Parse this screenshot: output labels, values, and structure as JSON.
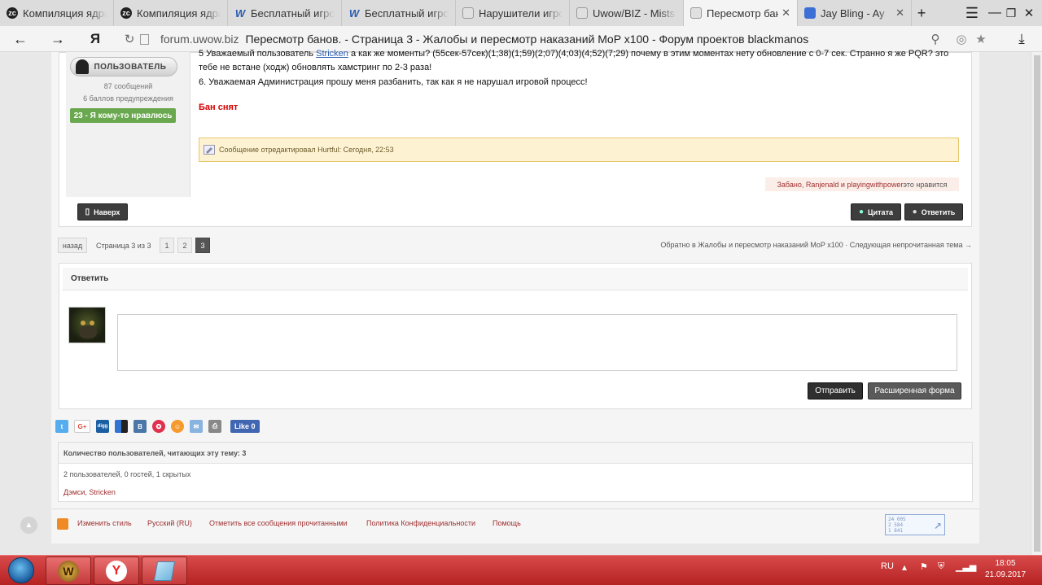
{
  "browser": {
    "tabs": [
      {
        "title": "Компиляция ядра",
        "icon": "zc"
      },
      {
        "title": "Компиляция ядра",
        "icon": "zc"
      },
      {
        "title": "Бесплатный игров",
        "icon": "w"
      },
      {
        "title": "Бесплатный игров",
        "icon": "w"
      },
      {
        "title": "Нарушители игров",
        "icon": "doc"
      },
      {
        "title": "Uwow/BIZ - Mists c",
        "icon": "doc"
      },
      {
        "title": "Пересмотр бано",
        "icon": "doc",
        "active": true
      },
      {
        "title": "Jay Bling - Ay",
        "icon": "blue"
      }
    ],
    "new_tab": "+",
    "domain": "forum.uwow.biz",
    "page_title": "Пересмотр банов. - Страница 3 - Жалобы и пересмотр наказаний MoP x100 - Форум проектов blackmanos",
    "yandex_logo": "Я"
  },
  "post": {
    "rank_label": "ПОЛЬЗОВАТЕЛЬ",
    "messages": "87 сообщений",
    "warnings": "6 баллов предупреждения",
    "likes_badge": "23 - Я кому-то нравлюсь",
    "line1_pre": "5 Уважаемый пользователь ",
    "line1_link": "Stricken",
    "line1_post": " а как же моменты? (55сек-57сек)(1;38)(1;59)(2;07)(4;03)(4;52)(7;29) почему в этим моментах  нету обновление с 0-7 сек. Странно я же PQR? это",
    "line2": "тебе не встане (ходж) обновлять хамстринг по 2-3 раза!",
    "line3": "6. Уважаемая Администрация прошу меня разбанить, так как я не нарушал игровой процесс!",
    "ban_lifted": "Бан снят",
    "edit_note": "Сообщение отредактировал Hurtful: Сегодня, 22:53",
    "likes_names": "Забано, Ranjenald и playingwithpower",
    "likes_suffix": " это нравится",
    "top_button": "Наверх",
    "quote_button": "Цитата",
    "reply_button": "Ответить"
  },
  "pagination": {
    "back": "назад",
    "page_of": "Страница 3 из 3",
    "pages": [
      "1",
      "2",
      "3"
    ],
    "current": "3",
    "back_link": "Обратно в Жалобы и пересмотр наказаний MoP x100 · Следующая непрочитанная тема →"
  },
  "reply": {
    "title": "Ответить",
    "textarea_value": "",
    "send": "Отправить",
    "advanced": "Расширенная форма"
  },
  "social": {
    "icons": [
      "twitter-icon",
      "google-plus-icon",
      "digg-icon",
      "delicious-icon",
      "vkontakte-icon",
      "star-icon",
      "odnoklassniki-icon",
      "mail-icon",
      "print-icon"
    ],
    "like_label": "Like 0"
  },
  "readers": {
    "header": "Количество пользователей, читающих эту тему: 3",
    "counts": "2 пользователей, 0 гостей, 1 скрытых",
    "names": "Дэмси, Stricken"
  },
  "footer": {
    "links": [
      "Изменить стиль",
      "Русский (RU)",
      "Отметить все сообщения прочитанными",
      "Политика Конфиденциальности",
      "Помощь"
    ],
    "counter_lines": [
      "24 005",
      "2 584",
      "1 841"
    ]
  },
  "taskbar": {
    "language": "RU",
    "time": "18:05",
    "date": "21.09.2017"
  },
  "colors": {
    "ban_lifted": "#d40000",
    "like_badge": "#6aa84f",
    "taskbar": "#c43a3a",
    "link": "#a03030"
  }
}
